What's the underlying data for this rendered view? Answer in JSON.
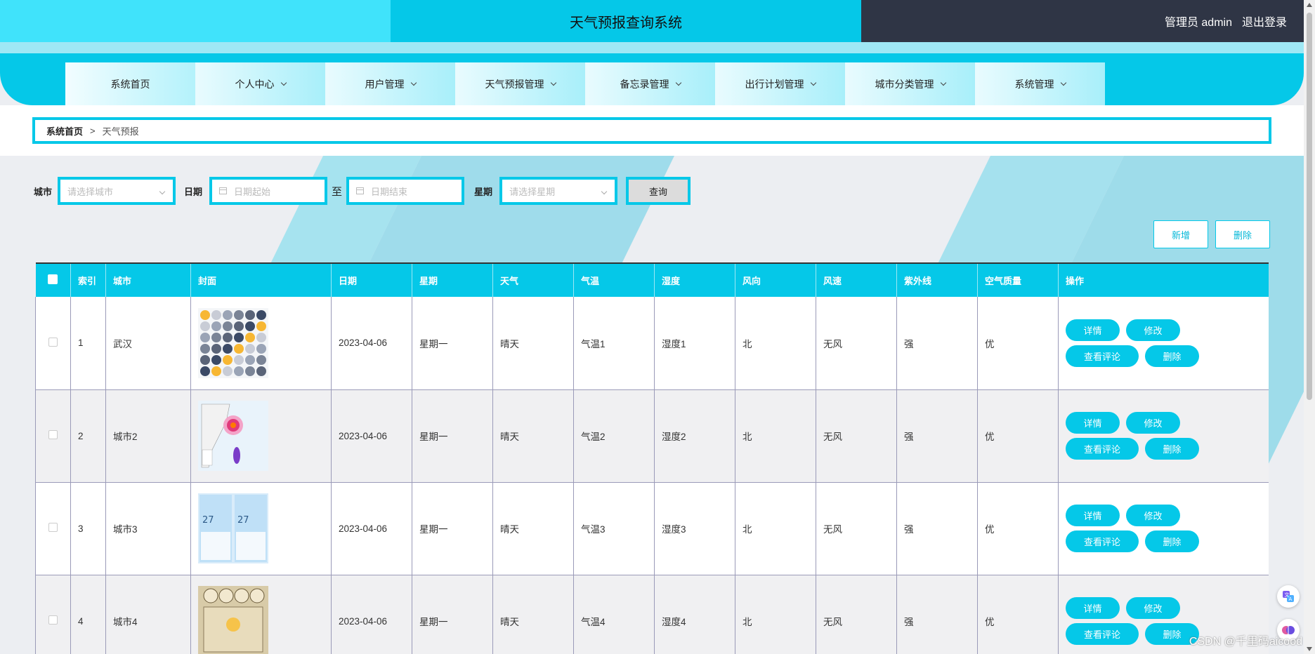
{
  "app": {
    "title": "天气预报查询系统"
  },
  "user": {
    "label": "管理员 admin",
    "logout": "退出登录"
  },
  "nav": [
    {
      "label": "系统首页",
      "has_dropdown": false
    },
    {
      "label": "个人中心",
      "has_dropdown": true
    },
    {
      "label": "用户管理",
      "has_dropdown": true
    },
    {
      "label": "天气预报管理",
      "has_dropdown": true
    },
    {
      "label": "备忘录管理",
      "has_dropdown": true
    },
    {
      "label": "出行计划管理",
      "has_dropdown": true
    },
    {
      "label": "城市分类管理",
      "has_dropdown": true
    },
    {
      "label": "系统管理",
      "has_dropdown": true
    }
  ],
  "breadcrumb": {
    "home": "系统首页",
    "sep": ">",
    "current": "天气预报"
  },
  "search": {
    "city_label": "城市",
    "city_placeholder": "请选择城市",
    "date_label": "日期",
    "date_start_placeholder": "日期起始",
    "to_label": "至",
    "date_end_placeholder": "日期结束",
    "week_label": "星期",
    "week_placeholder": "请选择星期",
    "query_button": "查询"
  },
  "toolbar": {
    "add": "新增",
    "delete": "删除"
  },
  "table": {
    "headers": [
      "",
      "索引",
      "城市",
      "封面",
      "日期",
      "星期",
      "天气",
      "气温",
      "湿度",
      "风向",
      "风速",
      "紫外线",
      "空气质量",
      "操作"
    ],
    "rows": [
      {
        "index": "1",
        "city": "武汉",
        "cover": "weather-icons-grid",
        "date": "2023-04-06",
        "week": "星期一",
        "weather": "晴天",
        "temp": "气温1",
        "humidity": "湿度1",
        "wind_dir": "北",
        "wind_speed": "无风",
        "uv": "强",
        "air": "优"
      },
      {
        "index": "2",
        "city": "城市2",
        "cover": "typhoon-map",
        "date": "2023-04-06",
        "week": "星期一",
        "weather": "晴天",
        "temp": "气温2",
        "humidity": "湿度2",
        "wind_dir": "北",
        "wind_speed": "无风",
        "uv": "强",
        "air": "优"
      },
      {
        "index": "3",
        "city": "城市3",
        "cover": "forecast-phone-screens",
        "date": "2023-04-06",
        "week": "星期一",
        "weather": "晴天",
        "temp": "气温3",
        "humidity": "湿度3",
        "wind_dir": "北",
        "wind_speed": "无风",
        "uv": "强",
        "air": "优"
      },
      {
        "index": "4",
        "city": "城市4",
        "cover": "today-weather-board",
        "date": "2023-04-06",
        "week": "星期一",
        "weather": "晴天",
        "temp": "气温4",
        "humidity": "湿度4",
        "wind_dir": "北",
        "wind_speed": "无风",
        "uv": "强",
        "air": "优"
      }
    ],
    "row_actions": {
      "detail": "详情",
      "edit": "修改",
      "comments": "查看评论",
      "delete": "删除"
    }
  },
  "float_icons": [
    "translate-icon",
    "brain-icon"
  ],
  "watermark": "CSDN @千里码aicood",
  "colors": {
    "accent": "#05c8e8",
    "accent_light": "#40e3fb",
    "dark": "#2f3545"
  }
}
